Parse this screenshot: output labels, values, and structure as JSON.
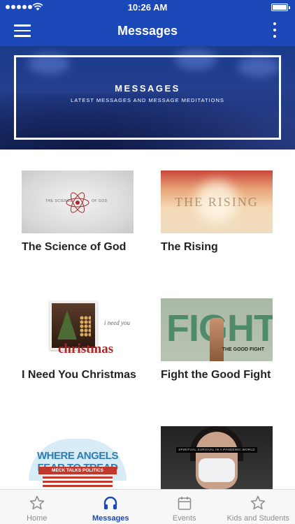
{
  "status_bar": {
    "time": "10:26 AM"
  },
  "nav": {
    "title": "Messages"
  },
  "hero": {
    "title": "MESSAGES",
    "subtitle": "LATEST MESSAGES AND MESSAGE MEDITATIONS"
  },
  "messages": [
    {
      "title": "The Science of God",
      "thumb_text_left": "THE SCIENCE",
      "thumb_text_right": "OF GOD"
    },
    {
      "title": "The Rising",
      "thumb_text": "THE RISING"
    },
    {
      "title": "I Need You Christmas",
      "thumb_script": "i need you",
      "thumb_word": "christmas"
    },
    {
      "title": "Fight the Good Fight",
      "thumb_word": "FIGHT",
      "thumb_sub": "THE GOOD FIGHT"
    },
    {
      "title": "",
      "thumb_head": "WHERE ANGELS FEAR TO TREAD",
      "thumb_band": "MECK TALKS POLITICS"
    },
    {
      "title": "",
      "thumb_bar": "SPIRITUAL SURVIVAL IN A PANDEMIC WORLD"
    }
  ],
  "tabs": [
    {
      "label": "Home",
      "icon": "star-icon"
    },
    {
      "label": "Messages",
      "icon": "headphones-icon",
      "active": true
    },
    {
      "label": "Events",
      "icon": "calendar-icon"
    },
    {
      "label": "Kids and Students",
      "icon": "star-icon"
    }
  ],
  "colors": {
    "primary": "#1a48b8",
    "tab_inactive": "#8e8e8e"
  }
}
